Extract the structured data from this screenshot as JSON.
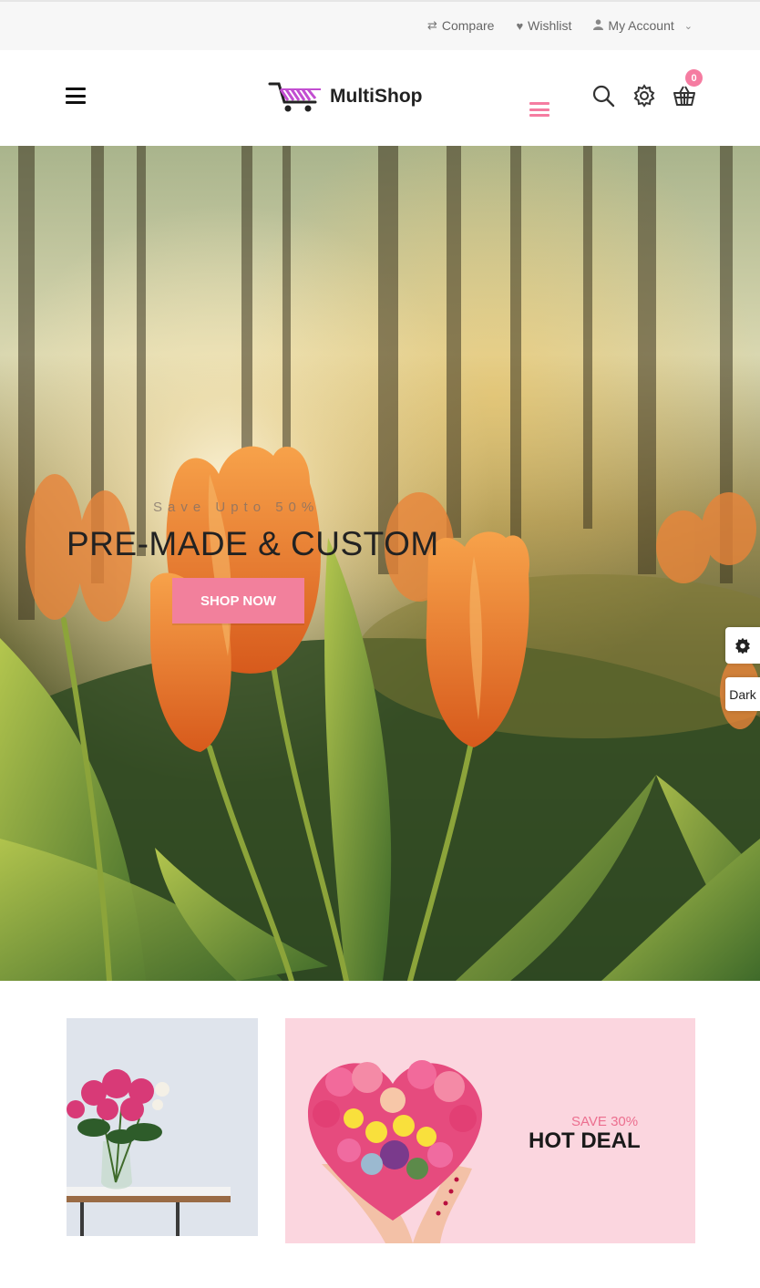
{
  "topbar": {
    "compare": {
      "icon": "shuffle-icon",
      "label": "Compare"
    },
    "wishlist": {
      "icon": "heart-icon",
      "label": "Wishlist"
    },
    "account": {
      "icon": "user-icon",
      "label": "My Account",
      "dropdown_icon": "chevron-down-icon"
    }
  },
  "header": {
    "logo_text": "MultiShop",
    "cart_count": "0",
    "colors": {
      "accent": "#f57ca1"
    }
  },
  "hero": {
    "subtitle": "Save Upto 50%",
    "title": "PRE-MADE & CUSTOM",
    "button": "SHOP NOW"
  },
  "side": {
    "settings_icon": "gear-icon",
    "dark_label": "Dark"
  },
  "banners": {
    "right": {
      "save_text": "SAVE 30%",
      "title": "HOT DEAL"
    }
  }
}
